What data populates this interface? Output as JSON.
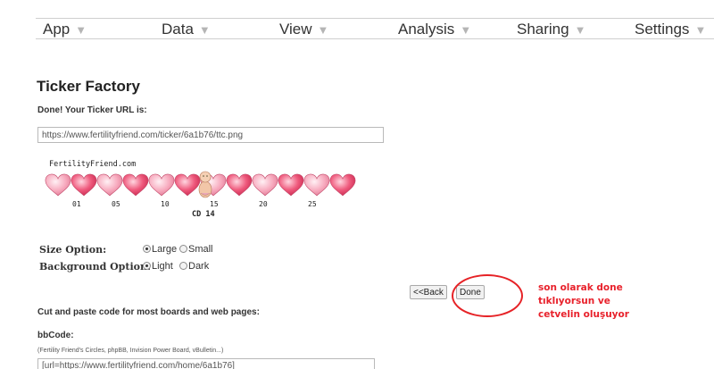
{
  "menu": [
    {
      "label": "App"
    },
    {
      "label": "Data"
    },
    {
      "label": "View"
    },
    {
      "label": "Analysis"
    },
    {
      "label": "Sharing"
    },
    {
      "label": "Settings"
    }
  ],
  "page": {
    "title": "Ticker Factory",
    "subtitle": "Done! Your Ticker URL is:",
    "url_value": "https://www.fertilityfriend.com/ticker/6a1b76/ttc.png"
  },
  "ticker": {
    "brand": "FertilityFriend.com",
    "day_labels": [
      "01",
      "05",
      "10",
      "15",
      "20",
      "25"
    ],
    "cd_label": "CD 14",
    "current_day": 14
  },
  "options": {
    "size_label": "Size Option:",
    "size_choices": [
      "Large",
      "Small"
    ],
    "size_selected": "Large",
    "bg_label": "Background Option:",
    "bg_choices": [
      "Light",
      "Dark"
    ],
    "bg_selected": "Light"
  },
  "buttons": {
    "back": "<<Back",
    "done": "Done"
  },
  "annotation": {
    "note": "son olarak  done\ntıklıyorsun ve\ncetvelin oluşuyor",
    "color": "#e8212b"
  },
  "code": {
    "cut_label": "Cut and paste code for most boards and web pages:",
    "bbcode_label": "bbCode:",
    "bbcode_hint": "(Fertility Friend's Circles, phpBB, Invision Power Board, vBulletin...)",
    "bbcode_value": "[url=https://www.fertilityfriend.com/home/6a1b76]"
  }
}
